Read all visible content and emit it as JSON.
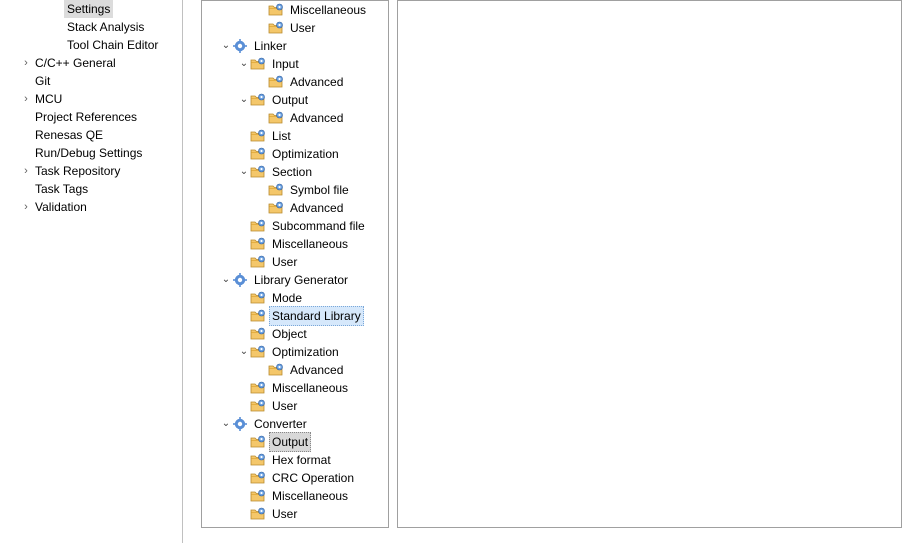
{
  "left_panel": {
    "items": [
      {
        "label": "Settings",
        "indent": 3,
        "arrow": false,
        "selected": true
      },
      {
        "label": "Stack Analysis",
        "indent": 3,
        "arrow": false,
        "selected": false
      },
      {
        "label": "Tool Chain Editor",
        "indent": 3,
        "arrow": false,
        "selected": false
      },
      {
        "label": "C/C++ General",
        "indent": 1,
        "arrow": true,
        "selected": false
      },
      {
        "label": "Git",
        "indent": 1,
        "arrow": false,
        "selected": false
      },
      {
        "label": "MCU",
        "indent": 1,
        "arrow": true,
        "selected": false
      },
      {
        "label": "Project References",
        "indent": 1,
        "arrow": false,
        "selected": false
      },
      {
        "label": "Renesas QE",
        "indent": 1,
        "arrow": false,
        "selected": false
      },
      {
        "label": "Run/Debug Settings",
        "indent": 1,
        "arrow": false,
        "selected": false
      },
      {
        "label": "Task Repository",
        "indent": 1,
        "arrow": true,
        "selected": false
      },
      {
        "label": "Task Tags",
        "indent": 1,
        "arrow": false,
        "selected": false
      },
      {
        "label": "Validation",
        "indent": 1,
        "arrow": true,
        "selected": false
      }
    ]
  },
  "tree": {
    "nodes": [
      {
        "depth": 3,
        "arrow": "",
        "icon": "folder",
        "label": "Miscellaneous"
      },
      {
        "depth": 3,
        "arrow": "",
        "icon": "folder",
        "label": "User"
      },
      {
        "depth": 1,
        "arrow": "open",
        "icon": "tool",
        "label": "Linker"
      },
      {
        "depth": 2,
        "arrow": "open",
        "icon": "folder",
        "label": "Input"
      },
      {
        "depth": 3,
        "arrow": "",
        "icon": "folder",
        "label": "Advanced"
      },
      {
        "depth": 2,
        "arrow": "open",
        "icon": "folder",
        "label": "Output"
      },
      {
        "depth": 3,
        "arrow": "",
        "icon": "folder",
        "label": "Advanced"
      },
      {
        "depth": 2,
        "arrow": "",
        "icon": "folder",
        "label": "List"
      },
      {
        "depth": 2,
        "arrow": "",
        "icon": "folder",
        "label": "Optimization"
      },
      {
        "depth": 2,
        "arrow": "open",
        "icon": "folder",
        "label": "Section"
      },
      {
        "depth": 3,
        "arrow": "",
        "icon": "folder",
        "label": "Symbol file"
      },
      {
        "depth": 3,
        "arrow": "",
        "icon": "folder",
        "label": "Advanced"
      },
      {
        "depth": 2,
        "arrow": "",
        "icon": "folder",
        "label": "Subcommand file"
      },
      {
        "depth": 2,
        "arrow": "",
        "icon": "folder",
        "label": "Miscellaneous"
      },
      {
        "depth": 2,
        "arrow": "",
        "icon": "folder",
        "label": "User"
      },
      {
        "depth": 1,
        "arrow": "open",
        "icon": "tool",
        "label": "Library Generator"
      },
      {
        "depth": 2,
        "arrow": "",
        "icon": "folder",
        "label": "Mode"
      },
      {
        "depth": 2,
        "arrow": "",
        "icon": "folder",
        "label": "Standard Library",
        "highlight": true
      },
      {
        "depth": 2,
        "arrow": "",
        "icon": "folder",
        "label": "Object"
      },
      {
        "depth": 2,
        "arrow": "open",
        "icon": "folder",
        "label": "Optimization"
      },
      {
        "depth": 3,
        "arrow": "",
        "icon": "folder",
        "label": "Advanced"
      },
      {
        "depth": 2,
        "arrow": "",
        "icon": "folder",
        "label": "Miscellaneous"
      },
      {
        "depth": 2,
        "arrow": "",
        "icon": "folder",
        "label": "User"
      },
      {
        "depth": 1,
        "arrow": "open",
        "icon": "tool",
        "label": "Converter"
      },
      {
        "depth": 2,
        "arrow": "",
        "icon": "folder",
        "label": "Output",
        "selected": true
      },
      {
        "depth": 2,
        "arrow": "",
        "icon": "folder",
        "label": "Hex format"
      },
      {
        "depth": 2,
        "arrow": "",
        "icon": "folder",
        "label": "CRC Operation"
      },
      {
        "depth": 2,
        "arrow": "",
        "icon": "folder",
        "label": "Miscellaneous"
      },
      {
        "depth": 2,
        "arrow": "",
        "icon": "folder",
        "label": "User"
      }
    ]
  },
  "glyphs": {
    "arrow_closed": "›",
    "arrow_open": "⌄"
  }
}
